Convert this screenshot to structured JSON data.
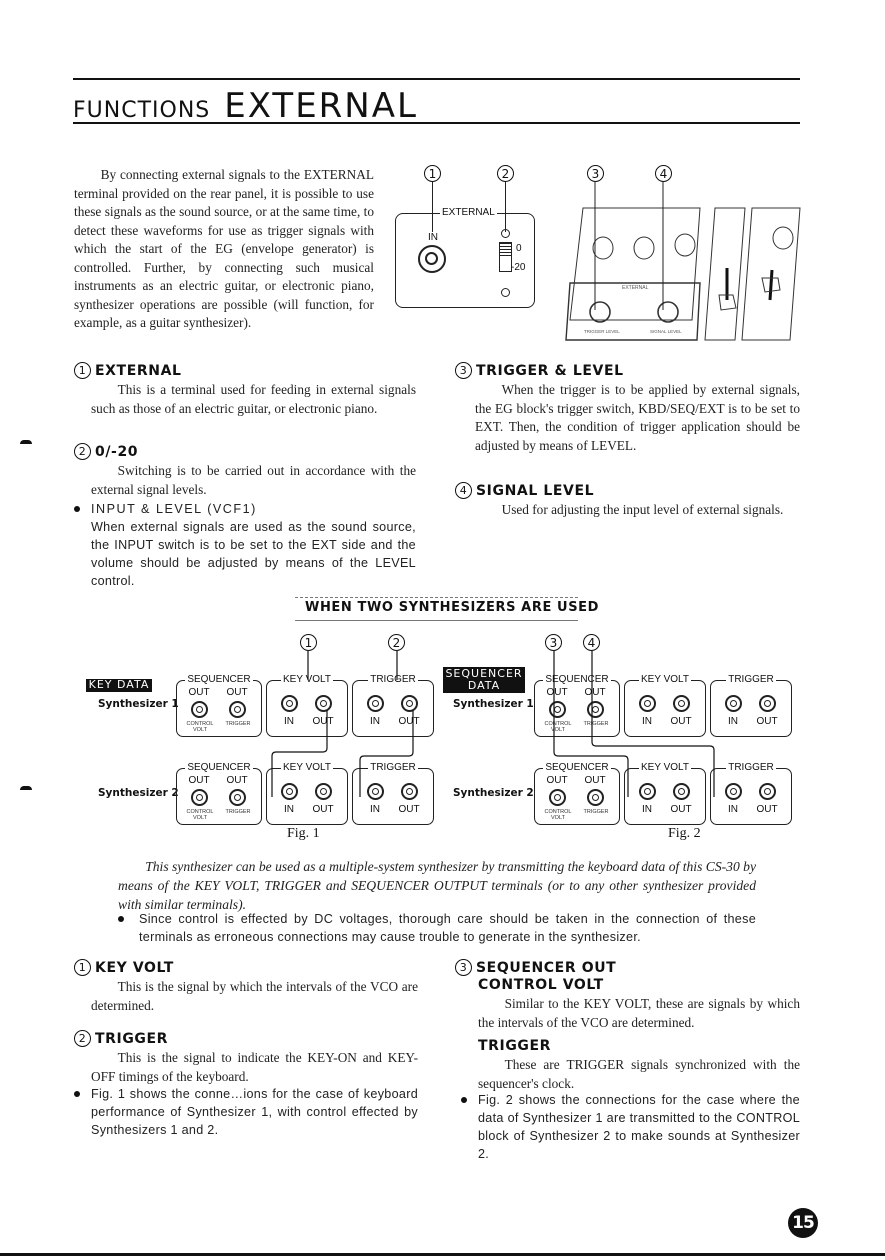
{
  "header": {
    "section": "FUNCTIONS",
    "title": "EXTERNAL"
  },
  "intro": "By connecting external signals to the EXTERNAL terminal provided on the rear panel, it is possible to use these signals as the sound source, or at the same time, to detect these waveforms for use as trigger signals with which the start of the EG (envelope generator) is controlled. Further, by connecting such musical instruments as an electric guitar, or electronic piano, synthesizer operations are possible (will function, for example, as a guitar synthesizer).",
  "panel_diagram": {
    "callouts": [
      "1",
      "2",
      "3",
      "4"
    ],
    "external_label": "EXTERNAL",
    "in_label": "IN",
    "switch_labels": [
      "0",
      "-20"
    ],
    "filter_label": "EXTERNAL",
    "knob_labels": [
      "TRIGGER LEVEL",
      "SIGNAL LEVEL"
    ]
  },
  "items_top": [
    {
      "num": "1",
      "title": "EXTERNAL",
      "body": "This is a terminal used for feeding in external signals such as those of an electric guitar, or electronic piano."
    },
    {
      "num": "2",
      "title": "0/-20",
      "body": "Switching is to be carried out in accordance with the external signal levels."
    },
    {
      "num": "3",
      "title": "TRIGGER & LEVEL",
      "body": "When the trigger is to be applied by external signals, the EG block's trigger switch, KBD/SEQ/EXT is to be set to EXT. Then, the condition of trigger application should be adjusted by means of LEVEL."
    },
    {
      "num": "4",
      "title": "SIGNAL LEVEL",
      "body": "Used for adjusting the input level of external signals."
    }
  ],
  "input_level_note": {
    "title": "INPUT & LEVEL (VCF1)",
    "body": "When external signals are used as the sound source, the INPUT switch is to be set to the EXT side and the volume should be adjusted by means of the LEVEL control."
  },
  "section2_title": "WHEN TWO SYNTHESIZERS ARE USED",
  "figures": {
    "fig1": {
      "badge": "KEY DATA",
      "caption": "Fig. 1",
      "callouts": [
        "1",
        "2"
      ]
    },
    "fig2": {
      "badge_line1": "SEQUENCER",
      "badge_line2": "DATA",
      "caption": "Fig. 2",
      "callouts": [
        "3",
        "4"
      ]
    },
    "labels": {
      "synth1": "Synthesizer 1",
      "synth2": "Synthesizer 2",
      "sequencer": "SEQUENCER",
      "key_volt": "KEY VOLT",
      "trigger": "TRIGGER",
      "out": "OUT",
      "in": "IN",
      "control_volt": "CONTROL VOLT",
      "trigger_small": "TRIGGER"
    }
  },
  "multi_para": "This synthesizer can be used as a multiple-system synthesizer by transmitting the keyboard data of this CS-30 by means of the KEY VOLT, TRIGGER and SEQUENCER OUTPUT terminals (or to any other synthesizer provided with similar terminals).",
  "dc_note": "Since control is effected by DC voltages, thorough care should be taken in the connection of these terminals as erroneous connections may cause trouble to generate in the synthesizer.",
  "items_bottom_left": [
    {
      "num": "1",
      "title": "KEY VOLT",
      "body": "This is the signal by which the intervals of the VCO are determined."
    },
    {
      "num": "2",
      "title": "TRIGGER",
      "body": "This is the signal to indicate the KEY-ON and KEY-OFF timings of the keyboard."
    }
  ],
  "fig1_note": "Fig. 1 shows the conne…ions for the case of keyboard performance of Synthesizer 1, with control effected by Synthesizers 1 and 2.",
  "items_bottom_right": {
    "num": "3",
    "title_line1": "SEQUENCER OUT",
    "title_line2": "CONTROL VOLT",
    "body1": "Similar to the KEY VOLT, these are signals by which the intervals of the VCO are determined.",
    "sub_title": "TRIGGER",
    "body2": "These are TRIGGER signals synchronized with the sequencer's clock."
  },
  "fig2_note": "Fig. 2 shows the connections for the case where the data of Synthesizer 1 are transmitted to the CONTROL block of Synthesizer 2 to make sounds at Synthesizer 2.",
  "page_number": "15"
}
